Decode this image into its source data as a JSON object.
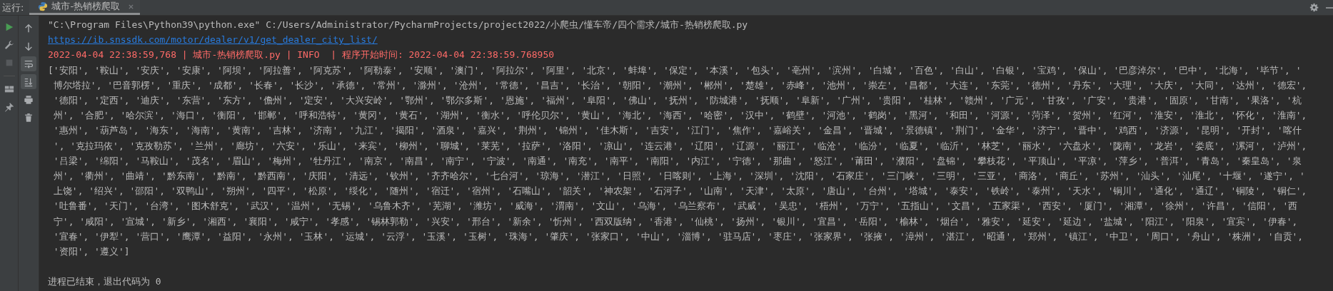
{
  "run_bar": {
    "label": "运行:",
    "tabs": [
      {
        "label": "城市-热销榜爬取",
        "selected": true
      }
    ]
  },
  "left_tools": [
    {
      "kind": "rerun",
      "disabled": false
    },
    {
      "kind": "settings",
      "disabled": false
    },
    {
      "kind": "stop",
      "disabled": true
    },
    {
      "kind": "layout",
      "disabled": false
    },
    {
      "kind": "pin",
      "disabled": false
    }
  ],
  "console_tools": [
    {
      "kind": "up",
      "selected": false
    },
    {
      "kind": "down",
      "selected": false
    },
    {
      "kind": "wrap",
      "selected": true
    },
    {
      "kind": "scroll_end",
      "selected": true
    },
    {
      "kind": "print",
      "selected": false
    },
    {
      "kind": "delete",
      "selected": false
    }
  ],
  "console_lines": [
    {
      "kind": "command",
      "text": "\"C:\\Program Files\\Python39\\python.exe\" C:/Users/Administrator/PycharmProjects/project2022/小爬虫/懂车帝/四个需求/城市-热销榜爬取.py"
    },
    {
      "kind": "link",
      "text": "https://ib.snssdk.com/motor/dealer/v1/get_dealer_city_list/"
    },
    {
      "kind": "log",
      "text": "2022-04-04 22:38:59,768 | 城市-热销榜爬取.py | INFO  | 程序开始时间: 2022-04-04 22:38:59.768950"
    },
    {
      "kind": "output",
      "text": "['安阳', '鞍山', '安庆', '安康', '阿坝', '阿拉善', '阿克苏', '阿勒泰', '安顺', '澳门', '阿拉尔', '阿里', '北京', '蚌埠', '保定', '本溪', '包头', '亳州', '滨州', '白城', '百色', '白山', '白银', '宝鸡', '保山', '巴彦淖尔', '巴中', '北海', '毕节', '"
    },
    {
      "kind": "wrapped",
      "text": "博尔塔拉', '巴音郭楞', '重庆', '成都', '长春', '长沙', '承德', '常州', '滁州', '沧州', '常德', '昌吉', '长治', '朝阳', '潮州', '郴州', '楚雄', '赤峰', '池州', '崇左', '昌都', '大连', '东莞', '德州', '丹东', '大理', '大庆', '大同', '达州', '德宏',"
    },
    {
      "kind": "wrapped",
      "text": "'德阳', '定西', '迪庆', '东营', '东方', '儋州', '定安', '大兴安岭', '鄂州', '鄂尔多斯', '恩施', '福州', '阜阳', '佛山', '抚州', '防城港', '抚顺', '阜新', '广州', '贵阳', '桂林', '赣州', '广元', '甘孜', '广安', '贵港', '固原', '甘南', '果洛', '杭"
    },
    {
      "kind": "wrapped",
      "text": "州', '合肥', '哈尔滨', '海口', '衡阳', '邯郸', '呼和浩特', '黄冈', '黄石', '湖州', '衡水', '呼伦贝尔', '黄山', '海北', '海西', '哈密', '汉中', '鹤壁', '河池', '鹤岗', '黑河', '和田', '河源', '菏泽', '贺州', '红河', '淮安', '淮北', '怀化', '淮南',"
    },
    {
      "kind": "wrapped",
      "text": "'惠州', '葫芦岛', '海东', '海南', '黄南', '吉林', '济南', '九江', '揭阳', '酒泉', '嘉兴', '荆州', '锦州', '佳木斯', '吉安', '江门', '焦作', '嘉峪关', '金昌', '晋城', '景德镇', '荆门', '金华', '济宁', '晋中', '鸡西', '济源', '昆明', '开封', '喀什"
    },
    {
      "kind": "wrapped",
      "text": "', '克拉玛依', '克孜勒苏', '兰州', '廊坊', '六安', '乐山', '来宾', '柳州', '聊城', '莱芜', '拉萨', '洛阳', '凉山', '连云港', '辽阳', '辽源', '丽江', '临沧', '临汾', '临夏', '临沂', '林芝', '丽水', '六盘水', '陇南', '龙岩', '娄底', '漯河', '泸州',"
    },
    {
      "kind": "wrapped",
      "text": "'吕梁', '绵阳', '马鞍山', '茂名', '眉山', '梅州', '牡丹江', '南京', '南昌', '南宁', '宁波', '南通', '南充', '南平', '南阳', '内江', '宁德', '那曲', '怒江', '莆田', '濮阳', '盘锦', '攀枝花', '平顶山', '平凉', '萍乡', '普洱', '青岛', '秦皇岛', '泉"
    },
    {
      "kind": "wrapped",
      "text": "州', '衢州', '曲靖', '黔东南', '黔南', '黔西南', '庆阳', '清远', '钦州', '齐齐哈尔', '七台河', '琼海', '潜江', '日照', '日喀则', '上海', '深圳', '沈阳', '石家庄', '三门峡', '三明', '三亚', '商洛', '商丘', '苏州', '汕头', '汕尾', '十堰', '遂宁', '"
    },
    {
      "kind": "wrapped",
      "text": "上饶', '绍兴', '邵阳', '双鸭山', '朔州', '四平', '松原', '绥化', '随州', '宿迁', '宿州', '石嘴山', '韶关', '神农架', '石河子', '山南', '天津', '太原', '唐山', '台州', '塔城', '泰安', '铁岭', '泰州', '天水', '铜川', '通化', '通辽', '铜陵', '铜仁',"
    },
    {
      "kind": "wrapped",
      "text": "'吐鲁番', '天门', '台湾', '图木舒克', '武汉', '温州', '无锡', '乌鲁木齐', '芜湖', '潍坊', '威海', '渭南', '文山', '乌海', '乌兰察布', '武威', '吴忠', '梧州', '万宁', '五指山', '文昌', '五家渠', '西安', '厦门', '湘潭', '徐州', '许昌', '信阳', '西"
    },
    {
      "kind": "wrapped",
      "text": "宁', '咸阳', '宣城', '新乡', '湘西', '襄阳', '咸宁', '孝感', '锡林郭勒', '兴安', '邢台', '新余', '忻州', '西双版纳', '香港', '仙桃', '扬州', '银川', '宜昌', '岳阳', '榆林', '烟台', '雅安', '延安', '延边', '盐城', '阳江', '阳泉', '宜宾', '伊春',"
    },
    {
      "kind": "wrapped",
      "text": "'宜春', '伊犁', '营口', '鹰潭', '益阳', '永州', '玉林', '运城', '云浮', '玉溪', '玉树', '珠海', '肇庆', '张家口', '中山', '淄博', '驻马店', '枣庄', '张家界', '张掖', '漳州', '湛江', '昭通', '郑州', '镇江', '中卫', '周口', '舟山', '株洲', '自贡',"
    },
    {
      "kind": "wrapped",
      "text": "'资阳', '遵义']"
    },
    {
      "kind": "exit",
      "text": "进程已结束，退出代码为 0"
    }
  ]
}
